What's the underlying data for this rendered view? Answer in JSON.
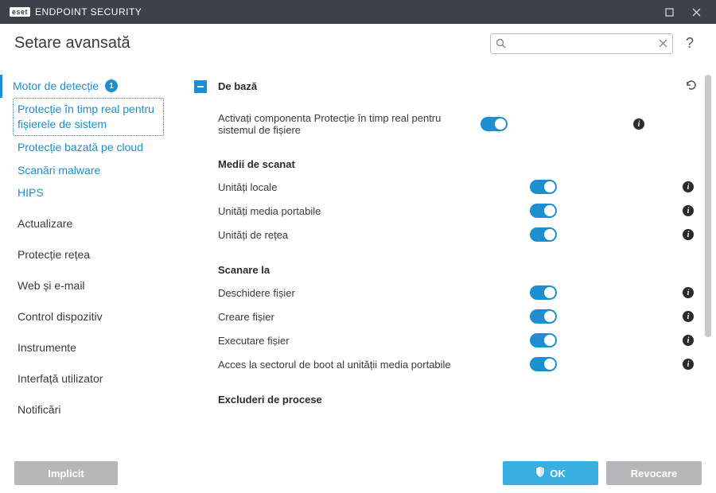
{
  "titlebar": {
    "logo_text": "eset",
    "product": "ENDPOINT SECURITY"
  },
  "header": {
    "title": "Setare avansată",
    "search_placeholder": "",
    "help": "?"
  },
  "sidebar": {
    "items": [
      {
        "label": "Motor de detecție",
        "badge": "1"
      },
      {
        "label": "Protecție în timp real pentru fișierele de sistem"
      },
      {
        "label": "Protecție bazată pe cloud"
      },
      {
        "label": "Scanări malware"
      },
      {
        "label": "HIPS"
      },
      {
        "label": "Actualizare"
      },
      {
        "label": "Protecție rețea"
      },
      {
        "label": "Web și e-mail"
      },
      {
        "label": "Control dispozitiv"
      },
      {
        "label": "Instrumente"
      },
      {
        "label": "Interfață utilizator"
      },
      {
        "label": "Notificări"
      }
    ]
  },
  "content": {
    "section_basic": "De bază",
    "row_enable": "Activați componenta Protecție în timp real pentru sistemul de fișiere",
    "sub_media": "Medii de scanat",
    "row_local": "Unități locale",
    "row_portable": "Unități media portabile",
    "row_network": "Unități de rețea",
    "sub_scanon": "Scanare la",
    "row_open": "Deschidere fișier",
    "row_create": "Creare fișier",
    "row_exec": "Executare fișier",
    "row_boot": "Acces la sectorul de boot al unității media portabile",
    "sub_exclude": "Excluderi de procese"
  },
  "footer": {
    "default": "Implicit",
    "ok": "OK",
    "cancel": "Revocare"
  }
}
